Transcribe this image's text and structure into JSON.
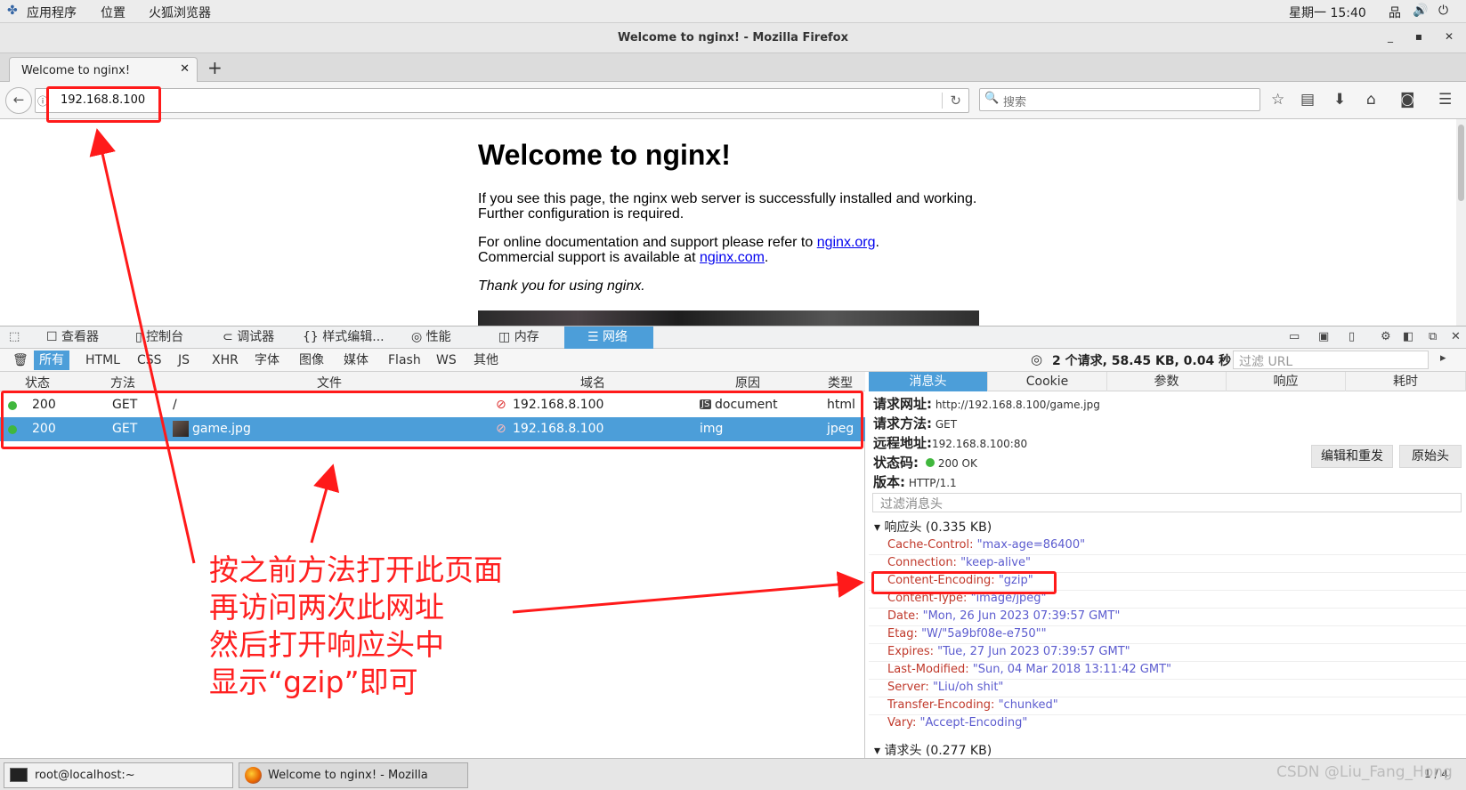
{
  "system_bar": {
    "apps": "应用程序",
    "places": "位置",
    "browser": "火狐浏览器",
    "clock": "星期一 15:40"
  },
  "window": {
    "title": "Welcome to nginx! - Mozilla Firefox"
  },
  "tabs": [
    {
      "label": "Welcome to nginx!"
    }
  ],
  "navbar": {
    "url": "192.168.8.100",
    "search_placeholder": "搜索"
  },
  "page": {
    "heading": "Welcome to nginx!",
    "p1_line1": "If you see this page, the nginx web server is successfully installed and working.",
    "p1_line2": "Further configuration is required.",
    "p2_line1_text": "For online documentation and support please refer to ",
    "p2_line1_link": "nginx.org",
    "p2_line1_end": ".",
    "p2_line2_text": "Commercial support is available at ",
    "p2_line2_link": "nginx.com",
    "p2_line2_end": ".",
    "thanks": "Thank you for using nginx."
  },
  "devtools": {
    "tabs": [
      "查看器",
      "控制台",
      "调试器",
      "样式编辑...",
      "性能",
      "内存",
      "网络"
    ],
    "selected_tab": "网络",
    "filters": [
      "所有",
      "HTML",
      "CSS",
      "JS",
      "XHR",
      "字体",
      "图像",
      "媒体",
      "Flash",
      "WS",
      "其他"
    ],
    "selected_filter": "所有",
    "summary": "2 个请求, 58.45 KB, 0.04 秒",
    "url_filter_placeholder": "过滤 URL",
    "columns": [
      "状态",
      "方法",
      "文件",
      "域名",
      "原因",
      "类型"
    ],
    "requests": [
      {
        "status": "200",
        "method": "GET",
        "file": "/",
        "domain": "192.168.8.100",
        "cause": "document",
        "type": "html"
      },
      {
        "status": "200",
        "method": "GET",
        "file": "game.jpg",
        "domain": "192.168.8.100",
        "cause": "img",
        "type": "jpeg"
      }
    ],
    "detail_tabs": [
      "消息头",
      "Cookie",
      "参数",
      "响应",
      "耗时"
    ],
    "detail": {
      "url_label": "请求网址:",
      "url_value": "http://192.168.8.100/game.jpg",
      "method_label": "请求方法:",
      "method_value": "GET",
      "remote_label": "远程地址:",
      "remote_value": "192.168.8.100:80",
      "status_label": "状态码:",
      "status_value": "200 OK",
      "version_label": "版本:",
      "version_value": "HTTP/1.1",
      "edit_resend": "编辑和重发",
      "raw_headers": "原始头",
      "header_filter_placeholder": "过滤消息头",
      "response_section": "响应头 (0.335 KB)",
      "request_section": "请求头 (0.277 KB)",
      "response_headers": [
        {
          "name": "Cache-Control:",
          "value": "\"max-age=86400\""
        },
        {
          "name": "Connection:",
          "value": "\"keep-alive\""
        },
        {
          "name": "Content-Encoding:",
          "value": "\"gzip\""
        },
        {
          "name": "Content-Type:",
          "value": "\"image/jpeg\""
        },
        {
          "name": "Date:",
          "value": "\"Mon, 26 Jun 2023 07:39:57 GMT\""
        },
        {
          "name": "Etag:",
          "value": "\"W/\"5a9bf08e-e750\"\""
        },
        {
          "name": "Expires:",
          "value": "\"Tue, 27 Jun 2023 07:39:57 GMT\""
        },
        {
          "name": "Last-Modified:",
          "value": "\"Sun, 04 Mar 2018 13:11:42 GMT\""
        },
        {
          "name": "Server:",
          "value": "\"Liu/oh shit\""
        },
        {
          "name": "Transfer-Encoding:",
          "value": "\"chunked\""
        },
        {
          "name": "Vary:",
          "value": "\"Accept-Encoding\""
        }
      ]
    }
  },
  "taskbar": {
    "terminal": "root@localhost:~",
    "firefox": "Welcome to nginx! - Mozilla Firefox",
    "pager": "1 / 4"
  },
  "annotation": {
    "line1": "按之前方法打开此页面",
    "line2": "再访问两次此网址",
    "line3": "然后打开响应头中",
    "line4": "显示“gzip”即可"
  },
  "watermark": "CSDN @Liu_Fang_Hong",
  "colors": {
    "accent": "#4c9ed9",
    "annotation_red": "#ff1a1a",
    "status_green": "#40b73d",
    "header_name": "#c0392b",
    "header_value": "#5c5ccf"
  }
}
